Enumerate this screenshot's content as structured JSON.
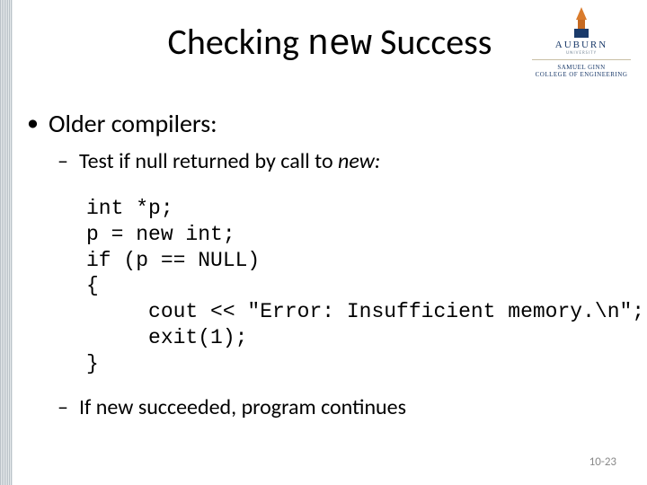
{
  "logo": {
    "university": "AUBURN",
    "subline": "UNIVERSITY",
    "college_line1": "SAMUEL GINN",
    "college_line2": "COLLEGE OF ENGINEERING"
  },
  "title": {
    "part1": "Checking ",
    "mono": "new",
    "part2": " Success"
  },
  "bullets": {
    "b1": "Older compilers:",
    "s1_prefix": "Test if null returned by call to ",
    "s1_italic": "new:",
    "s2": "If new succeeded, program continues"
  },
  "code": "int *p;\np = new int;\nif (p == NULL)\n{\n     cout << \"Error: Insufficient memory.\\n\";\n     exit(1);\n}",
  "page": "10-23"
}
